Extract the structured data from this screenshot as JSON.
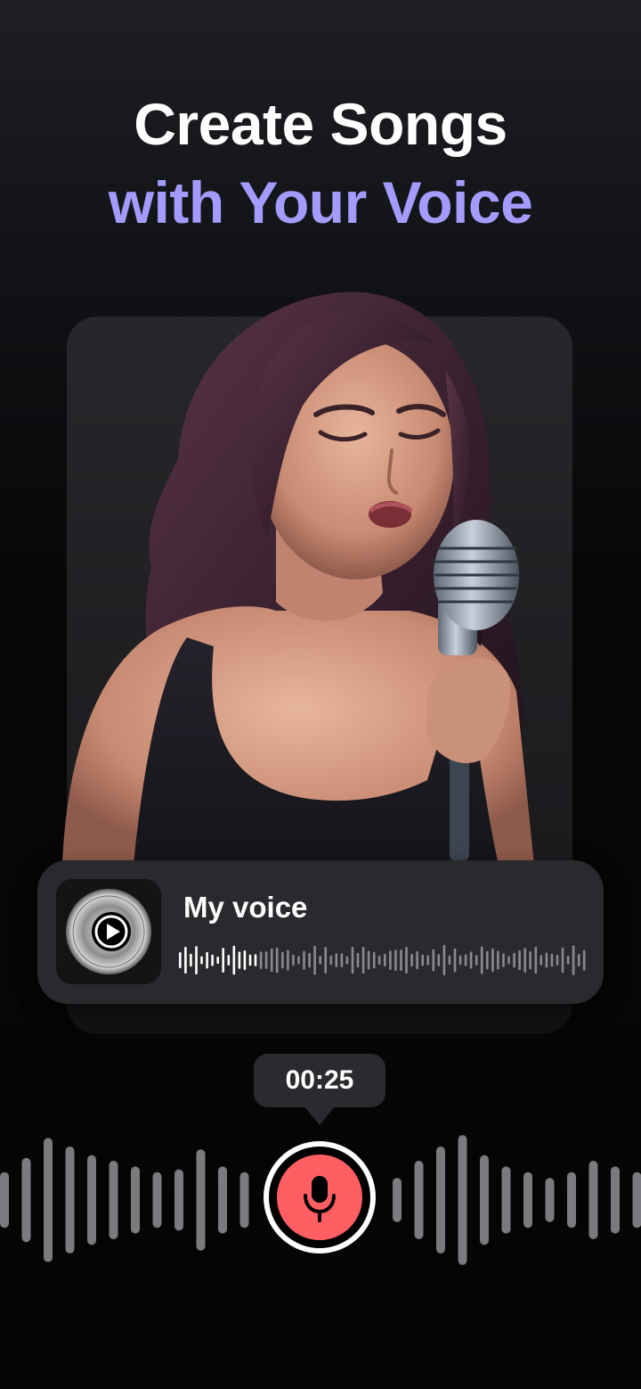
{
  "headline": {
    "line1": "Create Songs",
    "line2": "with Your Voice"
  },
  "colors": {
    "accent": "#a59bff",
    "record": "#ff5f63",
    "card": "#2a2a2e"
  },
  "voice_card": {
    "title": "My voice",
    "icon": "play-disc-icon",
    "progress": 0.2
  },
  "recorder": {
    "timer": "00:25",
    "icon": "microphone-icon",
    "state": "recording"
  },
  "illustration": {
    "subject": "woman-singing-into-microphone"
  }
}
